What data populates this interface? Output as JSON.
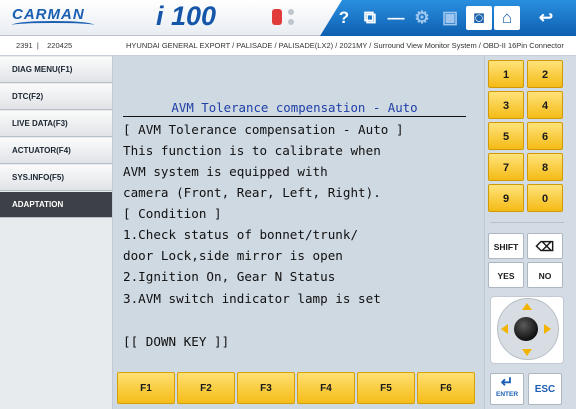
{
  "header": {
    "brand": "CARMAN",
    "device": "i 100",
    "icons": [
      "usb-icon",
      "help-icon",
      "window-icon",
      "minimize-icon",
      "settings-icon",
      "save-icon",
      "camera-icon",
      "home-icon",
      "back-icon"
    ],
    "help_glyph": "?",
    "window_glyph": "⧉",
    "min_glyph": "—",
    "settings_glyph": "⚙",
    "save_glyph": "▣",
    "camera_glyph": "◙",
    "home_glyph": "⌂",
    "back_glyph": "↩"
  },
  "infobar": {
    "left": "2391  |    220425",
    "path": "HYUNDAI GENERAL EXPORT / PALISADE / PALISADE(LX2) / 2021MY / Surround View Monitor System / OBD-II 16Pin Connector"
  },
  "sidebar": {
    "items": [
      {
        "label": "DIAG MENU(F1)"
      },
      {
        "label": "DTC(F2)"
      },
      {
        "label": "LIVE DATA(F3)"
      },
      {
        "label": "ACTUATOR(F4)"
      },
      {
        "label": "SYS.INFO(F5)"
      },
      {
        "label": "ADAPTATION"
      }
    ],
    "active_index": 5
  },
  "screen": {
    "title": "AVM Tolerance compensation - Auto",
    "lines": [
      "[ AVM Tolerance compensation - Auto ]",
      "This function is to calibrate when",
      "AVM system is equipped with",
      "camera (Front, Rear, Left, Right).",
      "[ Condition ]",
      "1.Check status of bonnet/trunk/",
      "door Lock,side mirror is open",
      "2.Ignition On, Gear N Status",
      "3.AVM switch indicator lamp is set",
      "",
      "[[ DOWN KEY ]]"
    ]
  },
  "fkeys": [
    "F1",
    "F2",
    "F3",
    "F4",
    "F5",
    "F6"
  ],
  "keypad": {
    "numbers": [
      "1",
      "2",
      "3",
      "4",
      "5",
      "6",
      "7",
      "8",
      "9",
      "0"
    ],
    "shift": "SHIFT",
    "backspace": "⌫",
    "yes": "YES",
    "no": "NO",
    "enter_glyph": "↵",
    "enter": "ENTER",
    "esc": "ESC"
  },
  "colors": {
    "header_blue": "#0e5fb0",
    "key_yellow": "#f4bb16",
    "screen_bg": "#cfd9e2",
    "title_blue": "#1f3fa6",
    "sidebar_active": "#3d4046"
  }
}
